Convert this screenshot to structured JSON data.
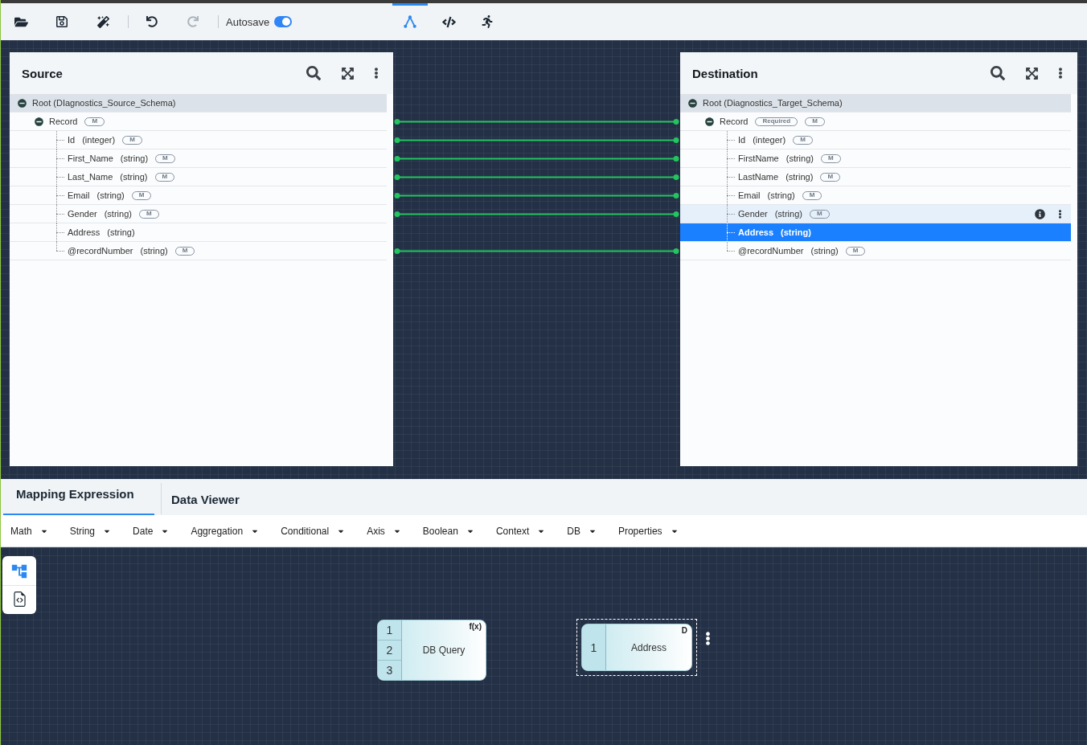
{
  "toolbar": {
    "button_groups": [
      [
        {
          "kind": "open",
          "disabled": false
        },
        {
          "kind": "save",
          "disabled": false
        },
        {
          "kind": "magic",
          "disabled": false
        }
      ],
      [
        {
          "kind": "undo",
          "disabled": false
        },
        {
          "kind": "redo",
          "disabled": true
        }
      ]
    ],
    "autosave": {
      "label": "Autosave",
      "on": true
    },
    "view_tabs": [
      {
        "kind": "mapping",
        "selected": true
      },
      {
        "kind": "code",
        "selected": false
      },
      {
        "kind": "run",
        "selected": false
      }
    ]
  },
  "source": {
    "title": "Source",
    "tree": [
      {
        "name": "Root (DIagnostics_Source_Schema)",
        "expanded": true,
        "selected": false,
        "hovered": false,
        "linked": false,
        "children": [
          {
            "name": "Record",
            "badges": [
              "M"
            ],
            "expanded": true,
            "selected": false,
            "hovered": false,
            "linked": true,
            "children": [
              {
                "name": "Id",
                "type": "(integer)",
                "badges": [
                  "M"
                ],
                "selected": false,
                "hovered": false,
                "linked": true
              },
              {
                "name": "First_Name",
                "type": "(string)",
                "badges": [
                  "M"
                ],
                "selected": false,
                "hovered": false,
                "linked": true
              },
              {
                "name": "Last_Name",
                "type": "(string)",
                "badges": [
                  "M"
                ],
                "selected": false,
                "hovered": false,
                "linked": true
              },
              {
                "name": "Email",
                "type": "(string)",
                "badges": [
                  "M"
                ],
                "selected": false,
                "hovered": false,
                "linked": true
              },
              {
                "name": "Gender",
                "type": "(string)",
                "badges": [
                  "M"
                ],
                "selected": false,
                "hovered": false,
                "linked": true
              },
              {
                "name": "Address",
                "type": "(string)",
                "selected": false,
                "hovered": false,
                "linked": false
              },
              {
                "name": "@recordNumber",
                "type": "(string)",
                "badges": [
                  "M"
                ],
                "selected": false,
                "hovered": false,
                "linked": true
              }
            ]
          }
        ]
      }
    ]
  },
  "destination": {
    "title": "Destination",
    "tree": [
      {
        "name": "Root (Diagnostics_Target_Schema)",
        "expanded": true,
        "selected": false,
        "hovered": false,
        "linked": false,
        "children": [
          {
            "name": "Record",
            "badges": [
              "Required",
              "M"
            ],
            "expanded": true,
            "selected": false,
            "hovered": false,
            "linked": true,
            "children": [
              {
                "name": "Id",
                "type": "(integer)",
                "badges": [
                  "M"
                ],
                "selected": false,
                "hovered": false,
                "linked": true
              },
              {
                "name": "FirstName",
                "type": "(string)",
                "badges": [
                  "M"
                ],
                "selected": false,
                "hovered": false,
                "linked": true
              },
              {
                "name": "LastName",
                "type": "(string)",
                "badges": [
                  "M"
                ],
                "selected": false,
                "hovered": false,
                "linked": true
              },
              {
                "name": "Email",
                "type": "(string)",
                "badges": [
                  "M"
                ],
                "selected": false,
                "hovered": false,
                "linked": true
              },
              {
                "name": "Gender",
                "type": "(string)",
                "badges": [
                  "M"
                ],
                "selected": false,
                "hovered": true,
                "linked": true
              },
              {
                "name": "Address",
                "type": "(string)",
                "selected": true,
                "hovered": false,
                "linked": false
              },
              {
                "name": "@recordNumber",
                "type": "(string)",
                "badges": [
                  "M"
                ],
                "selected": false,
                "hovered": false,
                "linked": true
              }
            ]
          }
        ]
      }
    ]
  },
  "bottom_tabs": [
    {
      "label": "Mapping Expression",
      "selected": true
    },
    {
      "label": "Data Viewer",
      "selected": false
    }
  ],
  "function_menu": [
    "Math",
    "String",
    "Date",
    "Aggregation",
    "Conditional",
    "Axis",
    "Boolean",
    "Context",
    "DB",
    "Properties"
  ],
  "canvas": {
    "tools": [
      {
        "kind": "flow",
        "selected": true
      },
      {
        "kind": "code",
        "selected": false
      }
    ],
    "nodes": [
      {
        "label": "DB Query",
        "badge": "f(x)",
        "ports": [
          "1",
          "2",
          "3"
        ],
        "selected": false
      },
      {
        "label": "Address",
        "badge": "D",
        "ports": [
          "1"
        ],
        "selected": true
      }
    ]
  }
}
